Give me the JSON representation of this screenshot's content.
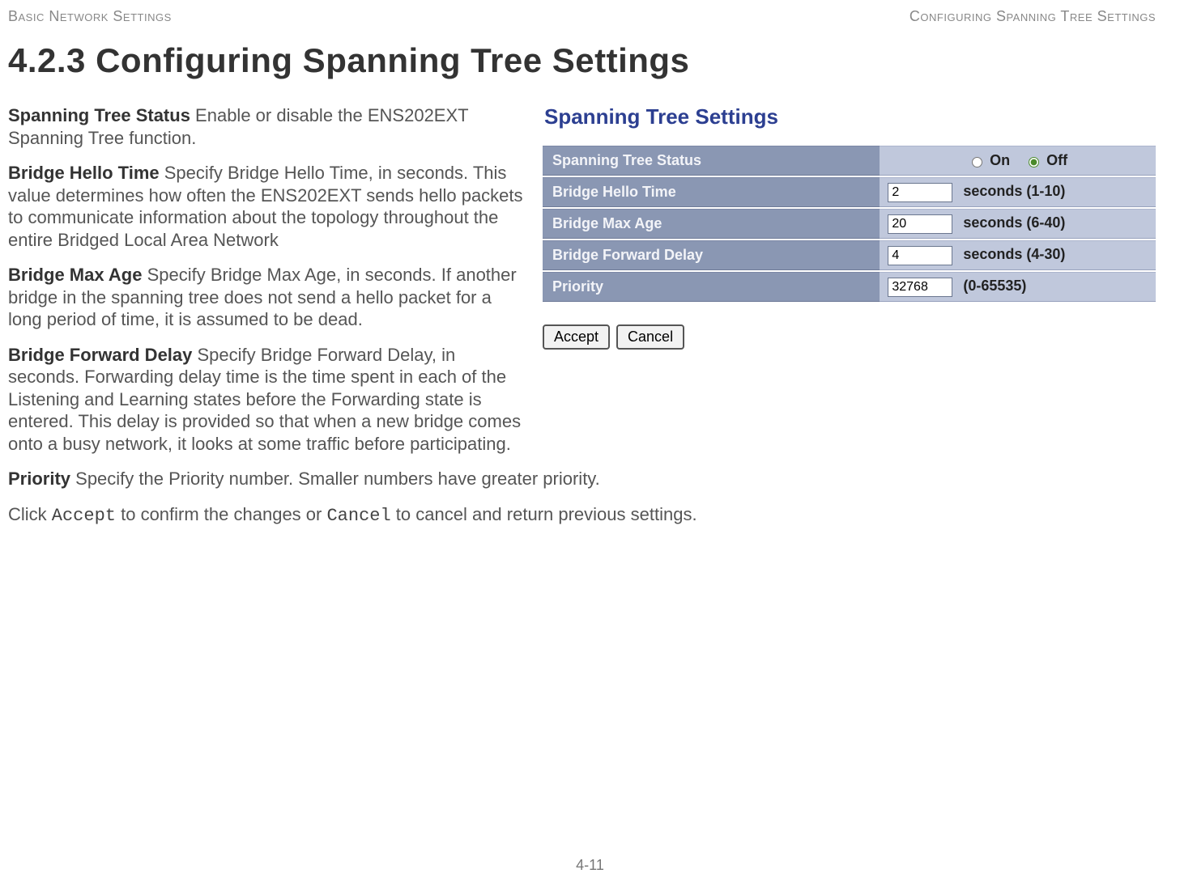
{
  "header": {
    "left": "Basic Network Settings",
    "right": "Configuring Spanning Tree Settings"
  },
  "section_title": "4.2.3 Configuring Spanning Tree Settings",
  "paragraphs": {
    "status_term": "Spanning Tree Status",
    "status_desc": "  Enable or disable the ENS202EXT Spanning Tree function.",
    "hello_term": "Bridge Hello Time",
    "hello_desc": "  Specify Bridge Hello Time, in seconds. This value determines how often the ENS202EXT sends hello packets to communicate information about the topology throughout the entire Bridged Local Area Network",
    "maxage_term": "Bridge Max Age",
    "maxage_desc": "  Specify Bridge Max Age, in seconds. If another bridge in the spanning tree does not send a hello packet for a long period of time, it is assumed to be dead.",
    "fwd_term": "Bridge Forward Delay",
    "fwd_desc": "  Specify Bridge Forward Delay, in seconds. Forwarding delay time is the time spent in each of the Listening and Learning states before the Forwarding state is entered. This delay is provided so that when a new bridge comes onto a busy network, it looks at some traffic before participating.",
    "priority_term": "Priority",
    "priority_desc": "  Specify the Priority number. Smaller numbers have greater priority.",
    "click_pre": "Click ",
    "accept_mono": "Accept",
    "click_mid": " to confirm the changes or ",
    "cancel_mono": "Cancel",
    "click_post": " to cancel and return previous settings."
  },
  "panel": {
    "title": "Spanning Tree Settings",
    "rows": {
      "status_label": "Spanning Tree Status",
      "status_on": "On",
      "status_off": "Off",
      "hello_label": "Bridge Hello Time",
      "hello_value": "2",
      "hello_hint": "seconds (1-10)",
      "maxage_label": "Bridge Max Age",
      "maxage_value": "20",
      "maxage_hint": "seconds (6-40)",
      "fwd_label": "Bridge Forward Delay",
      "fwd_value": "4",
      "fwd_hint": "seconds (4-30)",
      "priority_label": "Priority",
      "priority_value": "32768",
      "priority_hint": "(0-65535)"
    },
    "buttons": {
      "accept": "Accept",
      "cancel": "Cancel"
    }
  },
  "footer": "4-11"
}
